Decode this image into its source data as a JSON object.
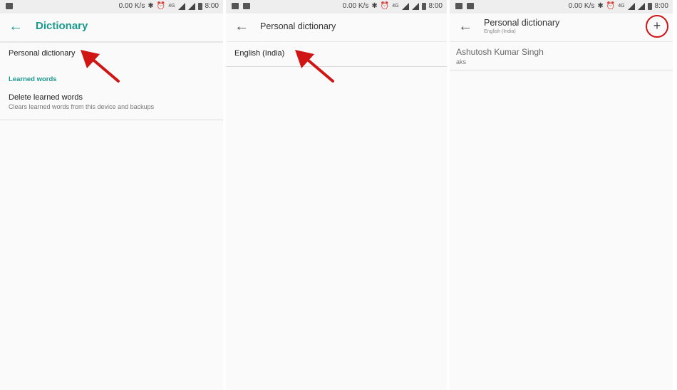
{
  "status": {
    "speed": "0.00 K/s",
    "time": "8:00",
    "network": "4G"
  },
  "screen1": {
    "title": "Dictionary",
    "personal_dictionary": "Personal dictionary",
    "section_label": "Learned words",
    "delete_title": "Delete learned words",
    "delete_subtitle": "Clears learned words from this device and backups"
  },
  "screen2": {
    "title": "Personal dictionary",
    "language_item": "English (India)"
  },
  "screen3": {
    "title": "Personal dictionary",
    "subtitle": "English (India)",
    "add_label": "+",
    "entry_word": "Ashutosh Kumar Singh",
    "entry_shortcut": "aks"
  },
  "colors": {
    "accent": "#1a9a8c",
    "highlight": "#d01515"
  }
}
